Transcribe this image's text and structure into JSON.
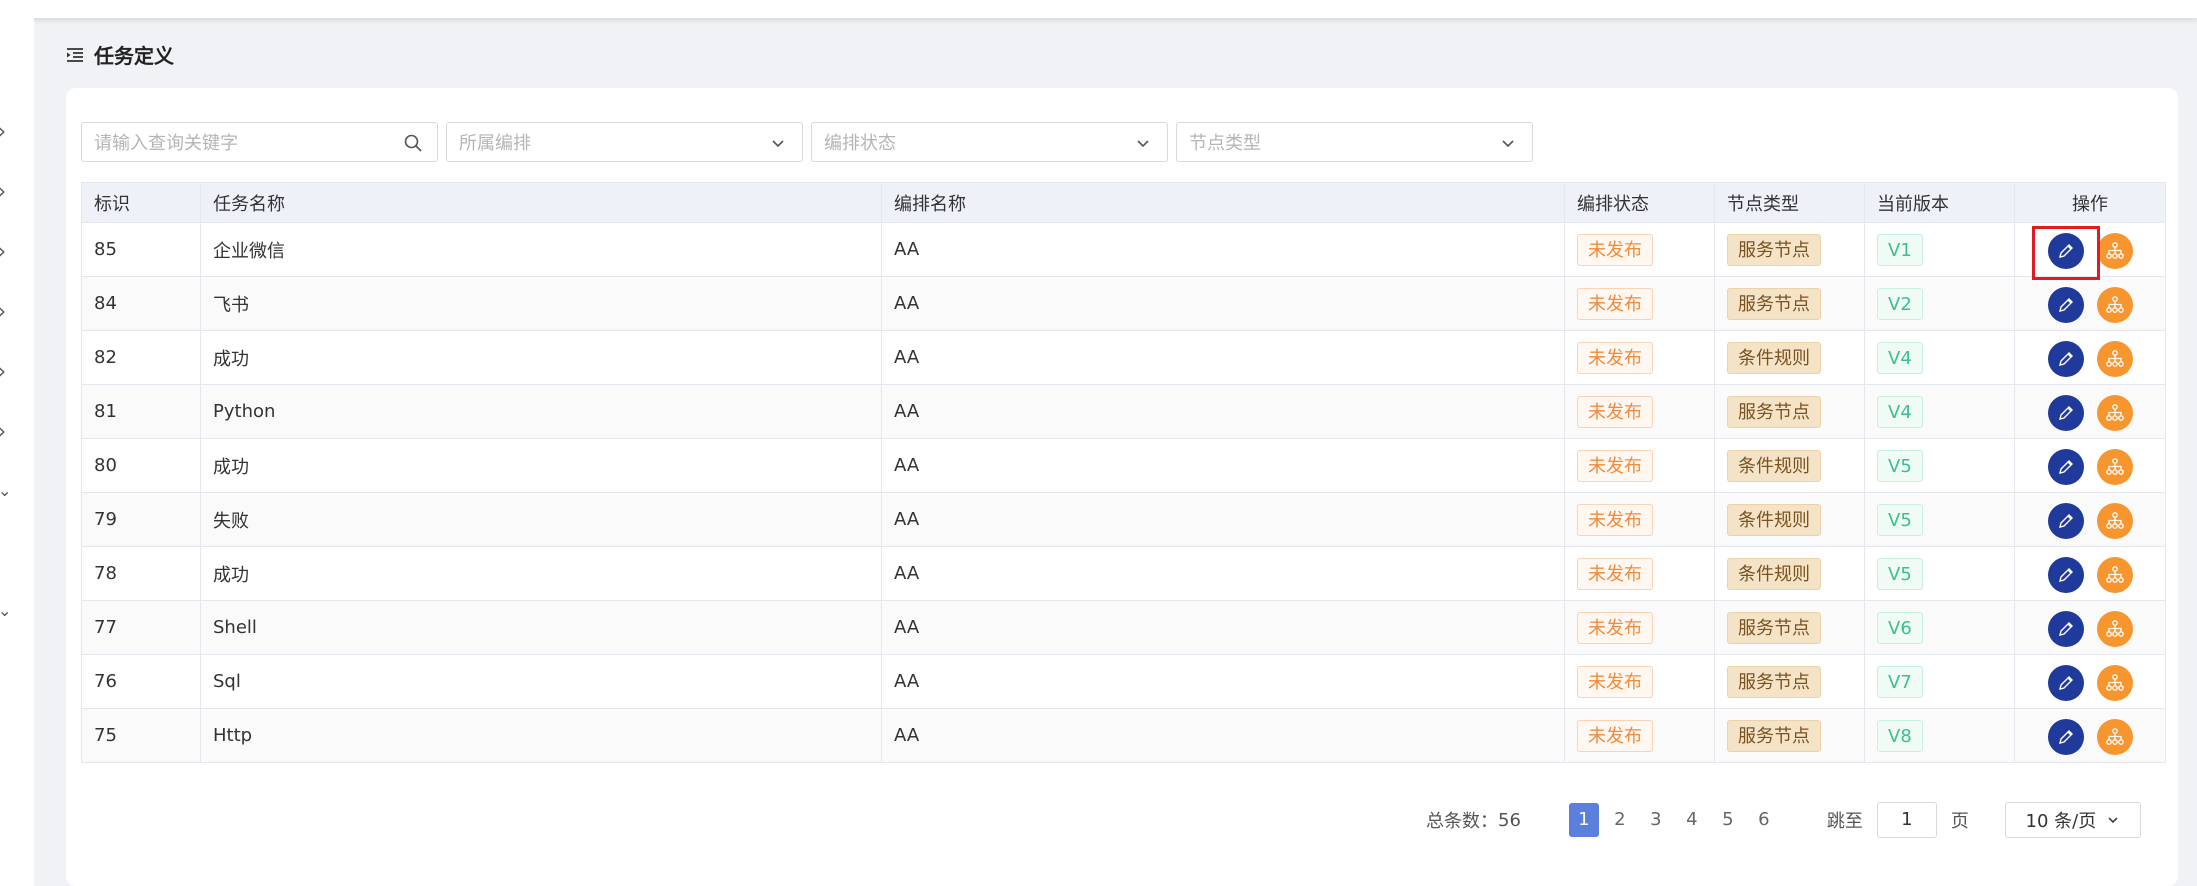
{
  "page": {
    "title": "任务定义"
  },
  "filters": {
    "search_placeholder": "请输入查询关键字",
    "orchestration_placeholder": "所属编排",
    "status_placeholder": "编排状态",
    "node_type_placeholder": "节点类型"
  },
  "table": {
    "headers": [
      "标识",
      "任务名称",
      "编排名称",
      "编排状态",
      "节点类型",
      "当前版本",
      "操作"
    ],
    "rows": [
      {
        "id": "85",
        "name": "企业微信",
        "orchestration": "AA",
        "status": "未发布",
        "node_type": "服务节点",
        "version": "V1"
      },
      {
        "id": "84",
        "name": "飞书",
        "orchestration": "AA",
        "status": "未发布",
        "node_type": "服务节点",
        "version": "V2"
      },
      {
        "id": "82",
        "name": "成功",
        "orchestration": "AA",
        "status": "未发布",
        "node_type": "条件规则",
        "version": "V4"
      },
      {
        "id": "81",
        "name": "Python",
        "orchestration": "AA",
        "status": "未发布",
        "node_type": "服务节点",
        "version": "V4"
      },
      {
        "id": "80",
        "name": "成功",
        "orchestration": "AA",
        "status": "未发布",
        "node_type": "条件规则",
        "version": "V5"
      },
      {
        "id": "79",
        "name": "失败",
        "orchestration": "AA",
        "status": "未发布",
        "node_type": "条件规则",
        "version": "V5"
      },
      {
        "id": "78",
        "name": "成功",
        "orchestration": "AA",
        "status": "未发布",
        "node_type": "条件规则",
        "version": "V5"
      },
      {
        "id": "77",
        "name": "Shell",
        "orchestration": "AA",
        "status": "未发布",
        "node_type": "服务节点",
        "version": "V6"
      },
      {
        "id": "76",
        "name": "Sql",
        "orchestration": "AA",
        "status": "未发布",
        "node_type": "服务节点",
        "version": "V7"
      },
      {
        "id": "75",
        "name": "Http",
        "orchestration": "AA",
        "status": "未发布",
        "node_type": "服务节点",
        "version": "V8"
      }
    ]
  },
  "pagination": {
    "total_label": "总条数：",
    "total": "56",
    "pages": [
      "1",
      "2",
      "3",
      "4",
      "5",
      "6"
    ],
    "current_page": "1",
    "jump_label": "跳至",
    "jump_value": "1",
    "page_suffix": "页",
    "page_size": "10 条/页"
  },
  "icons": {
    "title": "list-indent-icon",
    "search": "search-icon",
    "dropdown": "chevron-down-icon",
    "edit": "pencil-icon",
    "flow": "hierarchy-icon",
    "sidebar": "chevron-right-icon"
  },
  "colors": {
    "edit_button": "#1f3a9a",
    "flow_button": "#f7952f",
    "active_page": "#5b7fdc",
    "status_tag": "#f08a3c",
    "version_tag": "#3bbf8c",
    "highlight": "#e01b24"
  }
}
